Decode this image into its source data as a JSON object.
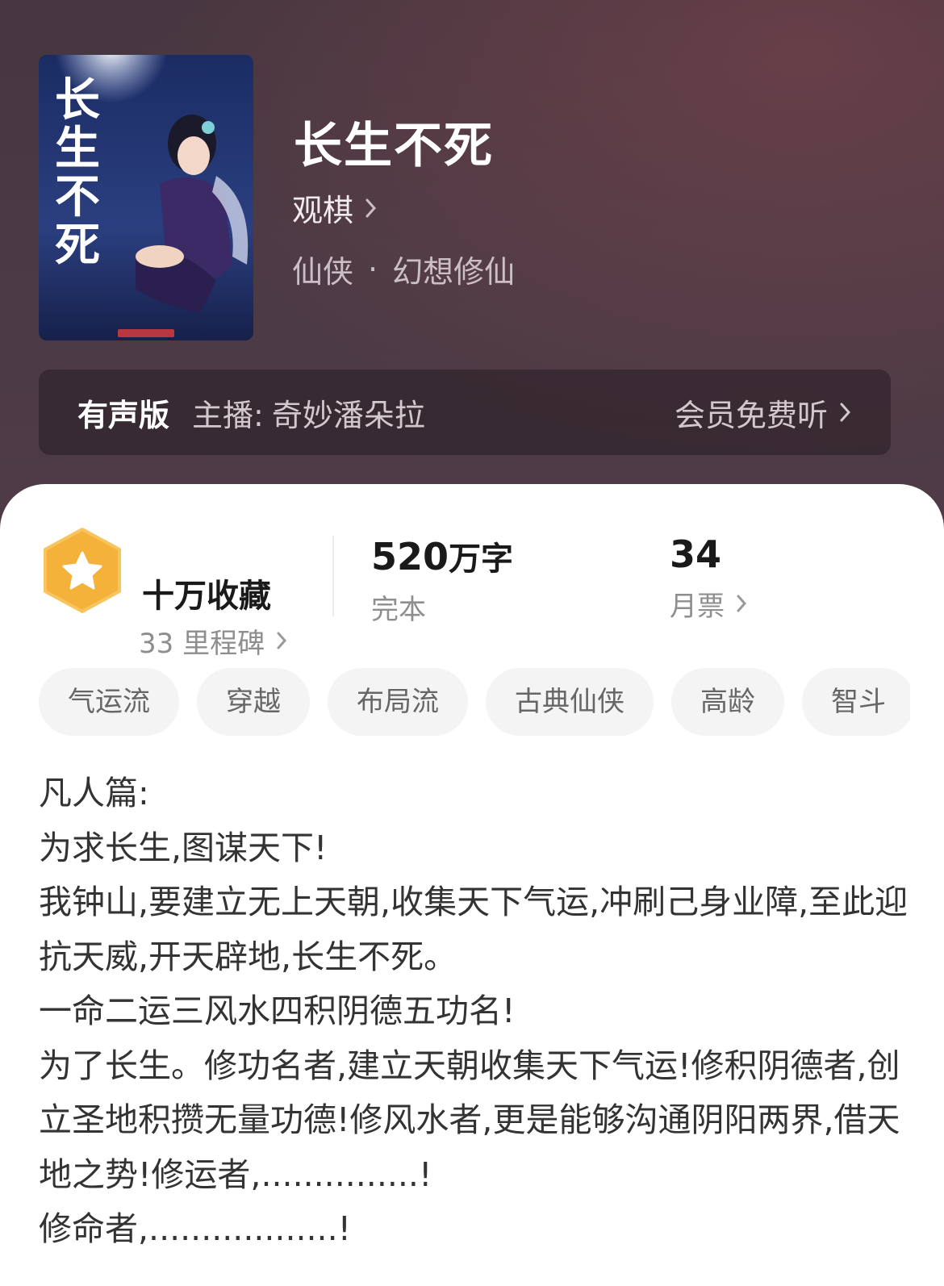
{
  "book": {
    "title": "长生不死",
    "author": "观棋",
    "genre_main": "仙侠",
    "genre_separator": "·",
    "genre_sub": "幻想修仙",
    "cover_text": "长生不死"
  },
  "audio": {
    "label": "有声版",
    "host_prefix": "主播:",
    "host_name": "奇妙潘朵拉",
    "action": "会员免费听"
  },
  "stats": {
    "collection": {
      "title": "十万收藏",
      "subtitle": "33 里程碑"
    },
    "words": {
      "number": "520",
      "unit": "万字",
      "status": "完本"
    },
    "monthly_votes": {
      "number": "34",
      "label": "月票"
    }
  },
  "tags": [
    "气运流",
    "穿越",
    "布局流",
    "古典仙侠",
    "高龄",
    "智斗"
  ],
  "description": [
    "凡人篇:",
    "为求长生,图谋天下!",
    "我钟山,要建立无上天朝,收集天下气运,冲刷己身业障,至此迎抗天威,开天辟地,长生不死。",
    "一命二运三风水四积阴德五功名!",
    "为了长生。修功名者,建立天朝收集天下气运!修积阴德者,创立圣地积攒无量功德!修风水者,更是能够沟通阴阳两界,借天地之势!修运者,...............!",
    "修命者,..................!"
  ],
  "colors": {
    "header_bg": "#4b3a44",
    "badge": "#f5b23a",
    "tag_bg": "#f4f4f4"
  }
}
